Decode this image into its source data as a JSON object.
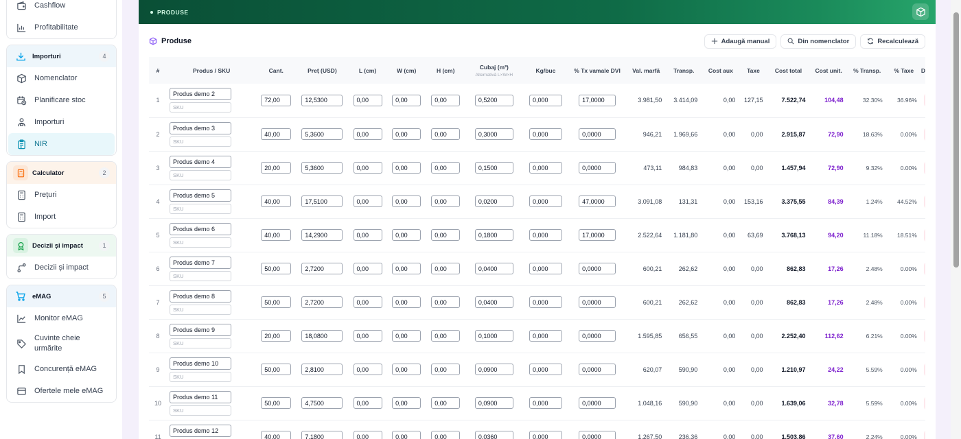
{
  "sidebar": {
    "top_items": [
      {
        "label": "Cashflow",
        "icon": "wallet-icon"
      },
      {
        "label": "Profitabilitate",
        "icon": "bar-chart-icon"
      }
    ],
    "groups": [
      {
        "title": "Importuri",
        "count": "4",
        "icon": "download-icon",
        "items": [
          {
            "label": "Nomenclator",
            "icon": "box-icon"
          },
          {
            "label": "Planificare stoc",
            "icon": "calendar-clock-icon"
          },
          {
            "label": "Importuri",
            "icon": "package-person-icon"
          },
          {
            "label": "NIR",
            "icon": "clipboard-icon",
            "active": true
          }
        ]
      },
      {
        "title": "Calculator",
        "count": "2",
        "icon": "calculator-icon",
        "items": [
          {
            "label": "Prețuri",
            "icon": "calculator-icon"
          },
          {
            "label": "Import",
            "icon": "calculator-icon"
          }
        ]
      },
      {
        "title": "Decizii și impact",
        "count": "1",
        "icon": "target-icon",
        "items": [
          {
            "label": "Decizii și impact",
            "icon": "route-icon"
          }
        ]
      },
      {
        "title": "eMAG",
        "count": "5",
        "icon": "cart-icon",
        "items": [
          {
            "label": "Monitor eMAG",
            "icon": "trend-icon"
          },
          {
            "label": "Cuvinte cheie urmărite",
            "icon": "tag-icon"
          },
          {
            "label": "Concurență eMAG",
            "icon": "bookmark-icon"
          },
          {
            "label": "Ofertele mele eMAG",
            "icon": "folder-icon"
          }
        ]
      }
    ]
  },
  "banner": {
    "label": "PRODUSE"
  },
  "panel": {
    "title": "Produse",
    "buttons": {
      "add_manual": "Adaugă manual",
      "from_catalog": "Din nomenclator",
      "recalc": "Recalculează"
    }
  },
  "table": {
    "headers": {
      "idx": "#",
      "product": "Produs / SKU",
      "qty": "Cant.",
      "price": "Preț (USD)",
      "l": "L (cm)",
      "w": "W (cm)",
      "h": "H (cm)",
      "cubaj": "Cubaj (m³)",
      "cubaj_sub": "Alternativă L×W×H",
      "kg": "Kg/buc",
      "customs": "% Tx vamale DVI",
      "val": "Val. marfă",
      "transp": "Transp.",
      "aux": "Cost aux",
      "tax": "Taxe",
      "total": "Cost total",
      "unit": "Cost unit.",
      "ptransp": "% Transp.",
      "ptax": "% Taxe",
      "del": "De"
    },
    "sku_placeholder": "SKU",
    "rows": [
      {
        "idx": "1",
        "name": "Produs demo 2",
        "qty": "72,00",
        "price": "12,5300",
        "l": "0,00",
        "w": "0,00",
        "h": "0,00",
        "cubaj": "0,5200",
        "kg": "0,000",
        "customs": "17,0000",
        "val": "3.981,50",
        "transp": "3.414,09",
        "aux": "0,00",
        "tax": "127,15",
        "total": "7.522,74",
        "unit": "104,48",
        "ptransp": "32.30%",
        "ptax": "36.96%"
      },
      {
        "idx": "2",
        "name": "Produs demo 3",
        "qty": "40,00",
        "price": "5,3600",
        "l": "0,00",
        "w": "0,00",
        "h": "0,00",
        "cubaj": "0,3000",
        "kg": "0,000",
        "customs": "0,0000",
        "val": "946,21",
        "transp": "1.969,66",
        "aux": "0,00",
        "tax": "0,00",
        "total": "2.915,87",
        "unit": "72,90",
        "ptransp": "18.63%",
        "ptax": "0.00%"
      },
      {
        "idx": "3",
        "name": "Produs demo 4",
        "qty": "20,00",
        "price": "5,3600",
        "l": "0,00",
        "w": "0,00",
        "h": "0,00",
        "cubaj": "0,1500",
        "kg": "0,000",
        "customs": "0,0000",
        "val": "473,11",
        "transp": "984,83",
        "aux": "0,00",
        "tax": "0,00",
        "total": "1.457,94",
        "unit": "72,90",
        "ptransp": "9.32%",
        "ptax": "0.00%"
      },
      {
        "idx": "4",
        "name": "Produs demo 5",
        "qty": "40,00",
        "price": "17,5100",
        "l": "0,00",
        "w": "0,00",
        "h": "0,00",
        "cubaj": "0,0200",
        "kg": "0,000",
        "customs": "47,0000",
        "val": "3.091,08",
        "transp": "131,31",
        "aux": "0,00",
        "tax": "153,16",
        "total": "3.375,55",
        "unit": "84,39",
        "ptransp": "1.24%",
        "ptax": "44.52%"
      },
      {
        "idx": "5",
        "name": "Produs demo 6",
        "qty": "40,00",
        "price": "14,2900",
        "l": "0,00",
        "w": "0,00",
        "h": "0,00",
        "cubaj": "0,1800",
        "kg": "0,000",
        "customs": "17,0000",
        "val": "2.522,64",
        "transp": "1.181,80",
        "aux": "0,00",
        "tax": "63,69",
        "total": "3.768,13",
        "unit": "94,20",
        "ptransp": "11.18%",
        "ptax": "18.51%"
      },
      {
        "idx": "6",
        "name": "Produs demo 7",
        "qty": "50,00",
        "price": "2,7200",
        "l": "0,00",
        "w": "0,00",
        "h": "0,00",
        "cubaj": "0,0400",
        "kg": "0,000",
        "customs": "0,0000",
        "val": "600,21",
        "transp": "262,62",
        "aux": "0,00",
        "tax": "0,00",
        "total": "862,83",
        "unit": "17,26",
        "ptransp": "2.48%",
        "ptax": "0.00%"
      },
      {
        "idx": "7",
        "name": "Produs demo 8",
        "qty": "50,00",
        "price": "2,7200",
        "l": "0,00",
        "w": "0,00",
        "h": "0,00",
        "cubaj": "0,0400",
        "kg": "0,000",
        "customs": "0,0000",
        "val": "600,21",
        "transp": "262,62",
        "aux": "0,00",
        "tax": "0,00",
        "total": "862,83",
        "unit": "17,26",
        "ptransp": "2.48%",
        "ptax": "0.00%"
      },
      {
        "idx": "8",
        "name": "Produs demo 9",
        "qty": "20,00",
        "price": "18,0800",
        "l": "0,00",
        "w": "0,00",
        "h": "0,00",
        "cubaj": "0,1000",
        "kg": "0,000",
        "customs": "0,0000",
        "val": "1.595,85",
        "transp": "656,55",
        "aux": "0,00",
        "tax": "0,00",
        "total": "2.252,40",
        "unit": "112,62",
        "ptransp": "6.21%",
        "ptax": "0.00%"
      },
      {
        "idx": "9",
        "name": "Produs demo 10",
        "qty": "50,00",
        "price": "2,8100",
        "l": "0,00",
        "w": "0,00",
        "h": "0,00",
        "cubaj": "0,0900",
        "kg": "0,000",
        "customs": "0,0000",
        "val": "620,07",
        "transp": "590,90",
        "aux": "0,00",
        "tax": "0,00",
        "total": "1.210,97",
        "unit": "24,22",
        "ptransp": "5.59%",
        "ptax": "0.00%"
      },
      {
        "idx": "10",
        "name": "Produs demo 11",
        "qty": "50,00",
        "price": "4,7500",
        "l": "0,00",
        "w": "0,00",
        "h": "0,00",
        "cubaj": "0,0900",
        "kg": "0,000",
        "customs": "0,0000",
        "val": "1.048,16",
        "transp": "590,90",
        "aux": "0,00",
        "tax": "0,00",
        "total": "1.639,06",
        "unit": "32,78",
        "ptransp": "5.59%",
        "ptax": "0.00%"
      },
      {
        "idx": "11",
        "name": "Produs demo 12",
        "qty": "40,00",
        "price": "7,1800",
        "l": "0,00",
        "w": "0,00",
        "h": "0,00",
        "cubaj": "0,0360",
        "kg": "0,000",
        "customs": "0,0000",
        "val": "1.267,50",
        "transp": "236,36",
        "aux": "0,00",
        "tax": "0,00",
        "total": "1.503,86",
        "unit": "37,60",
        "ptransp": "2.24%",
        "ptax": "0.00%"
      }
    ]
  }
}
